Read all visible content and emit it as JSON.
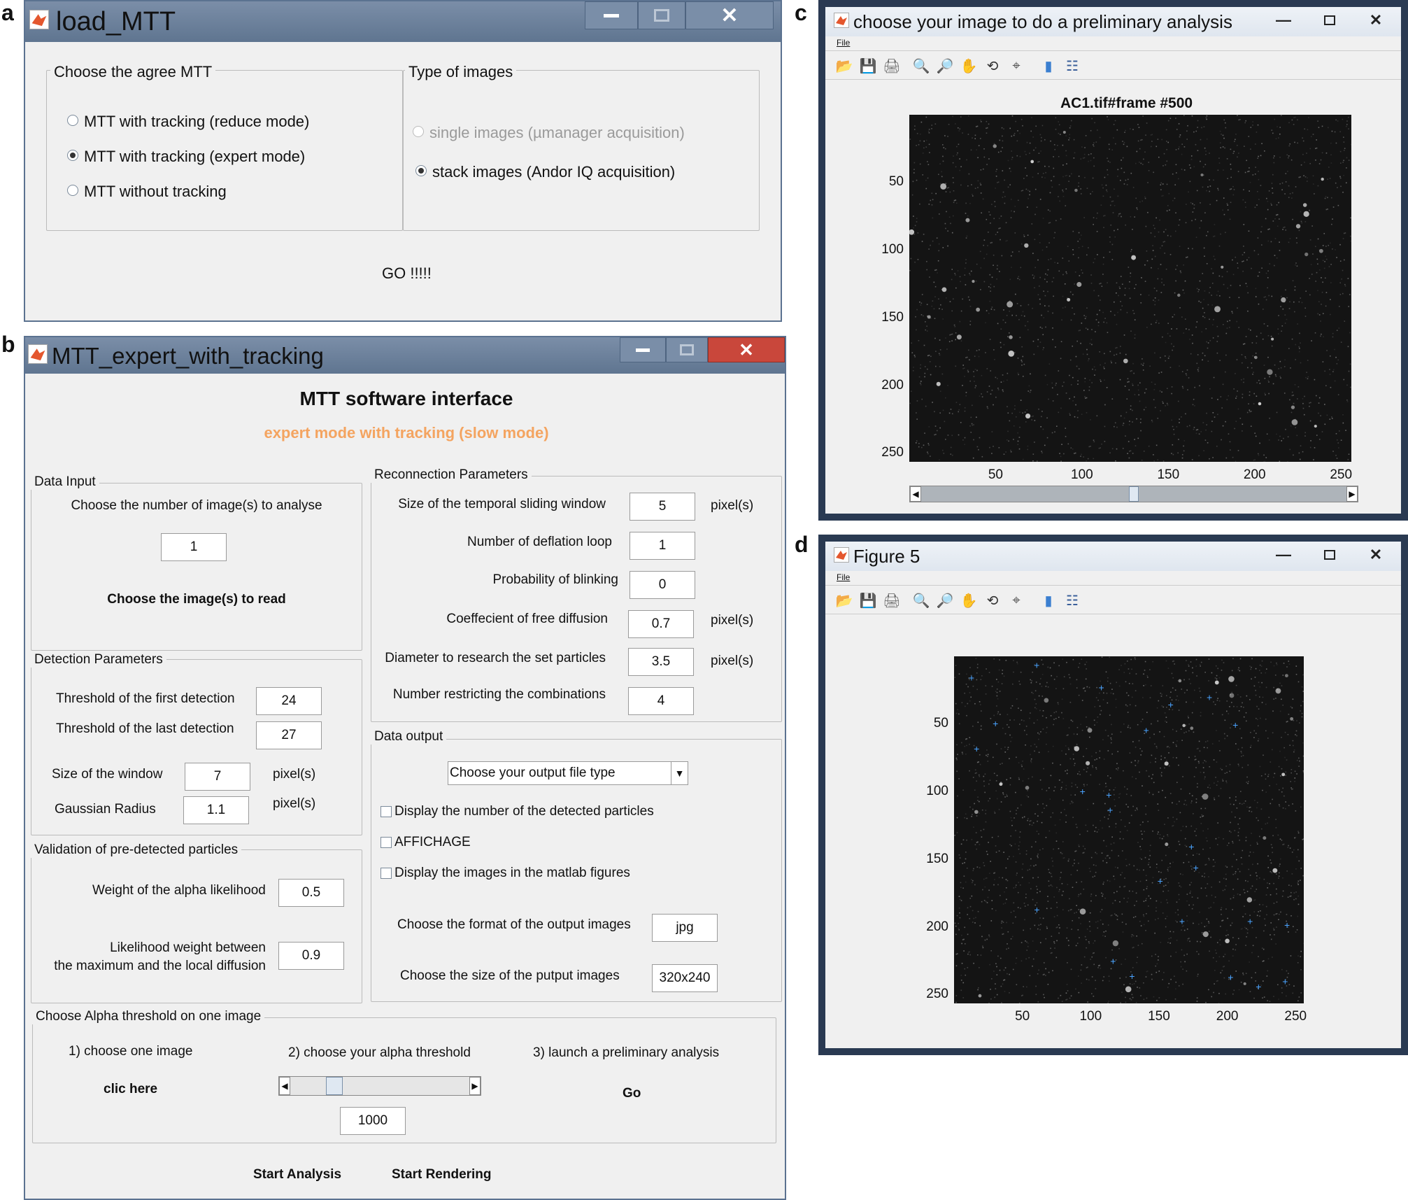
{
  "labels": {
    "a": "a",
    "b": "b",
    "c": "c",
    "d": "d"
  },
  "window_a": {
    "title": "load_MTT",
    "group_mtt": {
      "title": "Choose the agree MTT",
      "options": [
        {
          "label": "MTT with tracking (reduce mode)",
          "selected": false
        },
        {
          "label": "MTT with tracking (expert mode)",
          "selected": true
        },
        {
          "label": "MTT without tracking",
          "selected": false
        }
      ]
    },
    "group_images": {
      "title": "Type of images",
      "options": [
        {
          "label": "single images (µmanager acquisition)",
          "selected": false,
          "disabled": true
        },
        {
          "label": "stack images (Andor IQ acquisition)",
          "selected": true
        }
      ]
    },
    "go_label": "GO !!!!!"
  },
  "window_b": {
    "title": "MTT_expert_with_tracking",
    "heading": "MTT software interface",
    "subheading": "expert mode with tracking (slow mode)",
    "subheading_color": "#f4a460",
    "data_input": {
      "title": "Data Input",
      "prompt": "Choose the number of image(s) to analyse",
      "value": "1",
      "read_label": "Choose the image(s) to read"
    },
    "detection": {
      "title": "Detection Parameters",
      "first_label": "Threshold of the first detection",
      "first_value": "24",
      "last_label": "Threshold of the last detection",
      "last_value": "27",
      "window_label": "Size of the window",
      "window_value": "7",
      "window_unit": "pixel(s)",
      "radius_label": "Gaussian Radius",
      "radius_value": "1.1",
      "radius_unit": "pixel(s)"
    },
    "validation": {
      "title": "Validation of pre-detected particles",
      "alpha_label": "Weight of the alpha likelihood",
      "alpha_value": "0.5",
      "lik_label_1": "Likelihood weight between",
      "lik_label_2": "the maximum and the local diffusion",
      "lik_value": "0.9"
    },
    "reconnection": {
      "title": "Reconnection Parameters",
      "window_label": "Size of the temporal sliding window",
      "window_value": "5",
      "window_unit": "pixel(s)",
      "deflation_label": "Number of deflation loop",
      "deflation_value": "1",
      "blink_label": "Probability of blinking",
      "blink_value": "0",
      "diff_label": "Coeffecient of free diffusion",
      "diff_value": "0.7",
      "diff_unit": "pixel(s)",
      "diam_label": "Diameter to research the set particles",
      "diam_value": "3.5",
      "diam_unit": "pixel(s)",
      "comb_label": "Number restricting the combinations",
      "comb_value": "4"
    },
    "output": {
      "title": "Data output",
      "dropdown": "Choose your output file type",
      "check1": "Display the number of the detected particles",
      "check2": "AFFICHAGE",
      "check3": "Display the images in the matlab figures",
      "format_label": "Choose the format of the output images",
      "format_value": "jpg",
      "size_label": "Choose the size of the putput images",
      "size_value": "320x240"
    },
    "alpha": {
      "title": "Choose Alpha threshold on one image",
      "step1": "1) choose one image",
      "step2": "2) choose your alpha threshold",
      "step3": "3) launch a preliminary analysis",
      "click_here": "clic here",
      "go": "Go",
      "slider_value": "1000",
      "slider_position": 0.22
    },
    "start_analysis": "Start Analysis",
    "start_rendering": "Start Rendering"
  },
  "window_c": {
    "title": "choose your image to do a preliminary analysis",
    "menu_file": "File",
    "plot_title": "AC1.tif#frame #500",
    "y_ticks": [
      "50",
      "100",
      "150",
      "200",
      "250"
    ],
    "x_ticks": [
      "50",
      "100",
      "150",
      "200",
      "250"
    ],
    "slider_position": 0.5
  },
  "window_d": {
    "title": "Figure 5",
    "menu_file": "File",
    "y_ticks": [
      "50",
      "100",
      "150",
      "200",
      "250"
    ],
    "x_ticks": [
      "50",
      "100",
      "150",
      "200",
      "250"
    ],
    "marker_color": "#4aa3ff"
  },
  "toolbar_icons": [
    "open-icon",
    "save-icon",
    "print-icon",
    "zoom-in-icon",
    "zoom-out-icon",
    "pan-icon",
    "rotate-icon",
    "data-cursor-icon",
    "colorbar-icon",
    "legend-icon"
  ]
}
